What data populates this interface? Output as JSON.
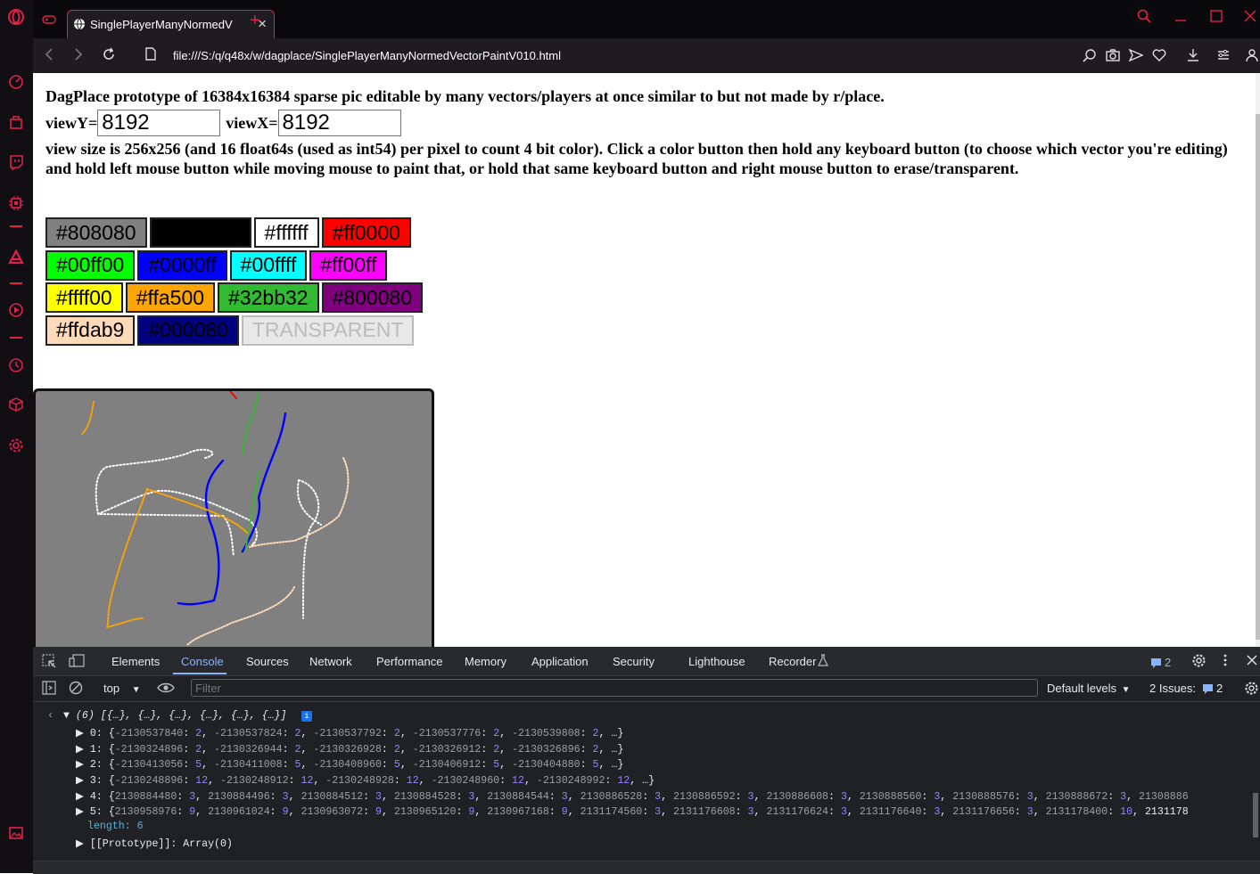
{
  "browser": {
    "tab_title": "SinglePlayerManyNormedV",
    "url": "file:///S:/q/q48x/w/dagplace/SinglePlayerManyNormedVectorPaintV010.html"
  },
  "page": {
    "heading": "DagPlace prototype of 16384x16384 sparse pic editable by many vectors/players at once similar to but not made by r/place.",
    "viewY_label": "viewY=",
    "viewY_value": "8192",
    "viewX_label": "viewX=",
    "viewX_value": "8192",
    "description": "view size is 256x256 (and 16 float64s (used as int54) per pixel to count 4 bit color). Click a color button then hold any keyboard button (to choose which vector you're editing) and hold left mouse button while moving mouse to paint that, or hold that same keyboard button and right mouse button to erase/transparent.",
    "palette": [
      [
        {
          "label": "#808080",
          "bg": "#808080",
          "fg": "#000000"
        },
        {
          "label": "",
          "bg": "#000000",
          "fg": "#000000",
          "w": 114
        },
        {
          "label": "#ffffff",
          "bg": "#ffffff",
          "fg": "#000000"
        },
        {
          "label": "#ff0000",
          "bg": "#ff0000",
          "fg": "#000000"
        }
      ],
      [
        {
          "label": "#00ff00",
          "bg": "#00ff00",
          "fg": "#000000"
        },
        {
          "label": "#0000ff",
          "bg": "#0000ff",
          "fg": "#000000"
        },
        {
          "label": "#00ffff",
          "bg": "#00ffff",
          "fg": "#000000"
        },
        {
          "label": "#ff00ff",
          "bg": "#ff00ff",
          "fg": "#000000"
        }
      ],
      [
        {
          "label": "#ffff00",
          "bg": "#ffff00",
          "fg": "#000000"
        },
        {
          "label": "#ffa500",
          "bg": "#ffa500",
          "fg": "#000000"
        },
        {
          "label": "#32bb32",
          "bg": "#32bb32",
          "fg": "#000000"
        },
        {
          "label": "#800080",
          "bg": "#800080",
          "fg": "#000000"
        }
      ],
      [
        {
          "label": "#ffdab9",
          "bg": "#ffdab9",
          "fg": "#000000"
        },
        {
          "label": "#000080",
          "bg": "#000080",
          "fg": "#000000"
        },
        {
          "label": "TRANSPARENT",
          "bg": "#e8e8e8",
          "fg": "#bbbbbb"
        }
      ]
    ]
  },
  "devtools": {
    "tabs": [
      "Elements",
      "Console",
      "Sources",
      "Network",
      "Performance",
      "Memory",
      "Application",
      "Security",
      "Lighthouse",
      "Recorder"
    ],
    "active_tab": "Console",
    "message_count": "2",
    "context": "top",
    "filter_placeholder": "Filter",
    "levels": "Default levels",
    "issues_label": "2 Issues:",
    "issues_count": "2",
    "console_lines": [
      "▼ (6) [{…}, {…}, {…}, {…}, {…}, {…}]",
      "▶ 0: {-2130537840: 2, -2130537824: 2, -2130537792: 2, -2130537776: 2, -2130539808: 2, …}",
      "▶ 1: {-2130324896: 2, -2130326944: 2, -2130326928: 2, -2130326912: 2, -2130326896: 2, …}",
      "▶ 2: {-2130413056: 5, -2130411008: 5, -2130408960: 5, -2130406912: 5, -2130404880: 5, …}",
      "▶ 3: {-2130248896: 12, -2130248912: 12, -2130248928: 12, -2130248960: 12, -2130248992: 12, …}",
      "▶ 4: {2130884480: 3, 2130884496: 3, 2130884512: 3, 2130884528: 3, 2130884544: 3, 2130886528: 3, 2130886592: 3, 2130886608: 3, 2130888560: 3, 2130888576: 3, 2130888672: 3, 21308886",
      "▶ 5: {2130958976: 9, 2130961024: 9, 2130963072: 9, 2130965120: 9, 2130967168: 9, 2131174560: 3, 2131176608: 3, 2131176624: 3, 2131176640: 3, 2131176656: 3, 2131178400: 10, 2131178",
      "length: 6",
      "▶ [[Prototype]]: Array(0)"
    ]
  },
  "colors": {
    "accent": "#e0224a",
    "devtools_blue": "#8ab4f8"
  }
}
